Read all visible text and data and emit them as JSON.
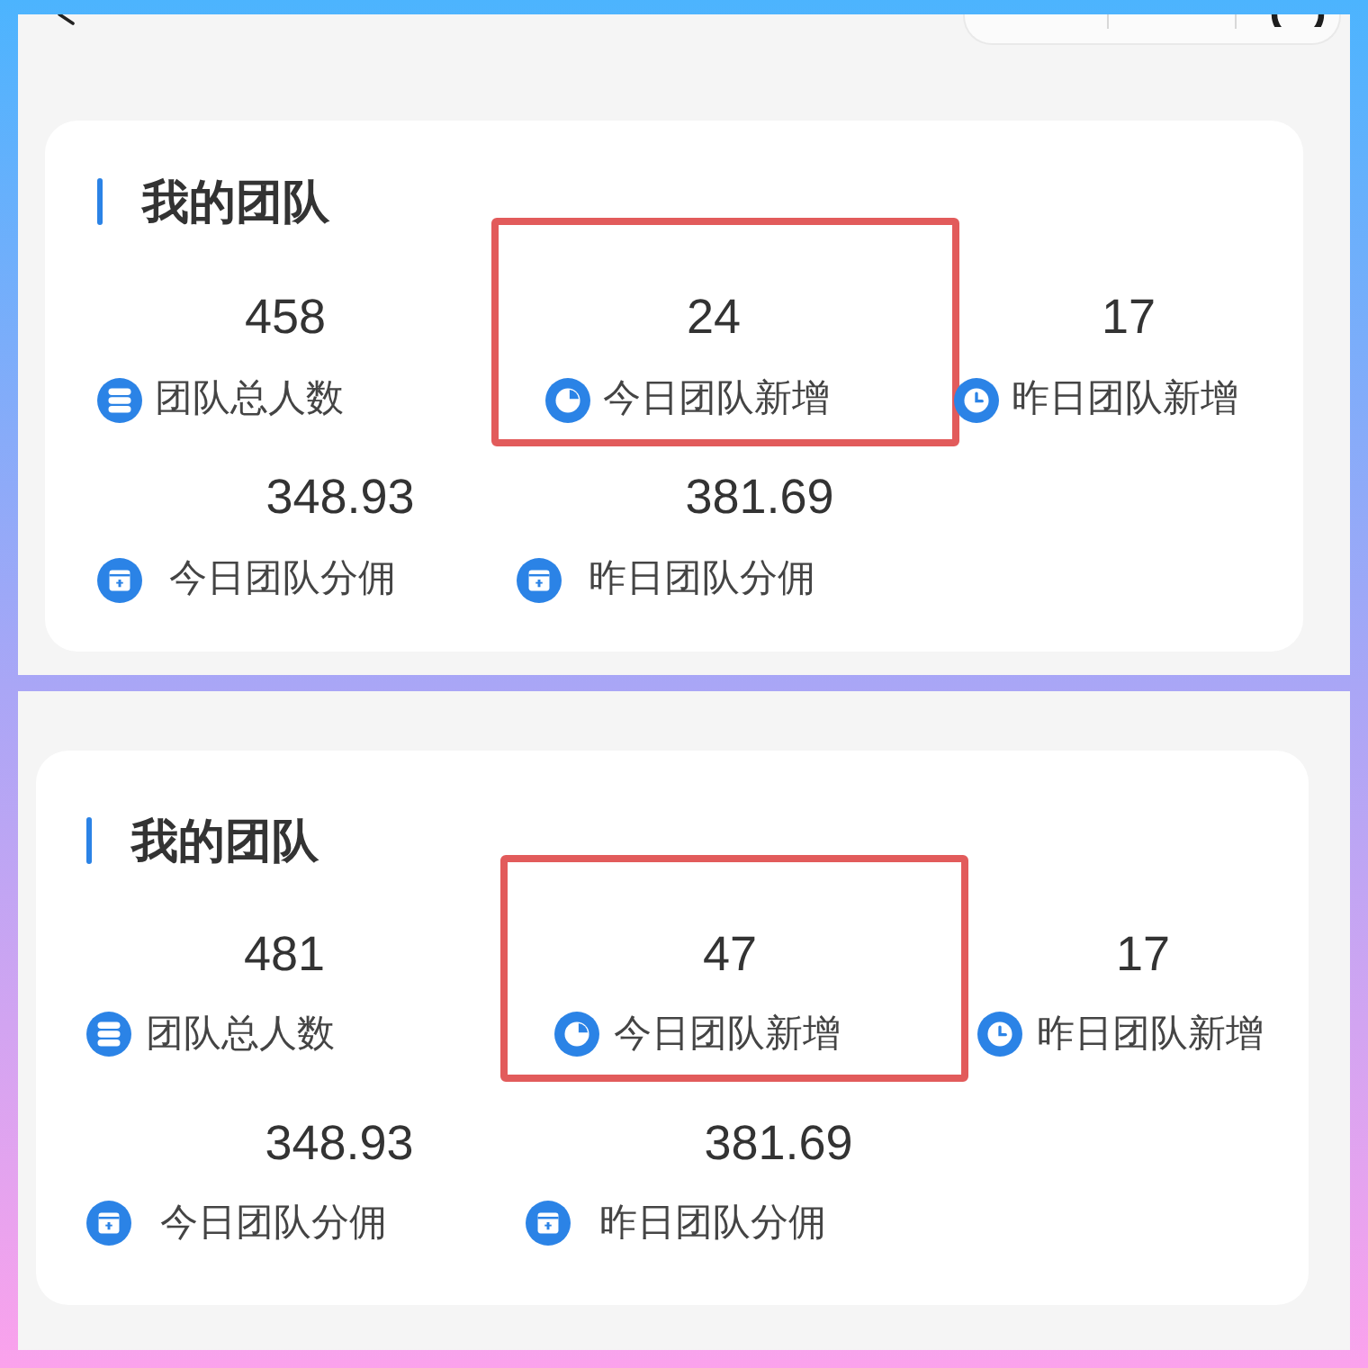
{
  "panels": [
    {
      "kind": "navbar",
      "card": {
        "title": "我的团队",
        "rows": [
          [
            {
              "kind": "members",
              "value": "458",
              "label": "团队总人数",
              "highlighted": false
            },
            {
              "kind": "today",
              "value": "24",
              "label": "今日团队新增",
              "highlighted": true
            },
            {
              "kind": "yesterday",
              "value": "17",
              "label": "昨日团队新增",
              "highlighted": false
            }
          ],
          [
            {
              "kind": "commission",
              "value": "348.93",
              "label": "今日团队分佣",
              "highlighted": false
            },
            {
              "kind": "commission",
              "value": "381.69",
              "label": "昨日团队分佣",
              "highlighted": false
            }
          ]
        ]
      }
    },
    {
      "kind": "plain",
      "card": {
        "title": "我的团队",
        "rows": [
          [
            {
              "kind": "members",
              "value": "481",
              "label": "团队总人数",
              "highlighted": false
            },
            {
              "kind": "today",
              "value": "47",
              "label": "今日团队新增",
              "highlighted": true
            },
            {
              "kind": "yesterday",
              "value": "17",
              "label": "昨日团队新增",
              "highlighted": false
            }
          ],
          [
            {
              "kind": "commission",
              "value": "348.93",
              "label": "今日团队分佣",
              "highlighted": false
            },
            {
              "kind": "commission",
              "value": "381.69",
              "label": "昨日团队分佣",
              "highlighted": false
            }
          ]
        ]
      }
    }
  ]
}
